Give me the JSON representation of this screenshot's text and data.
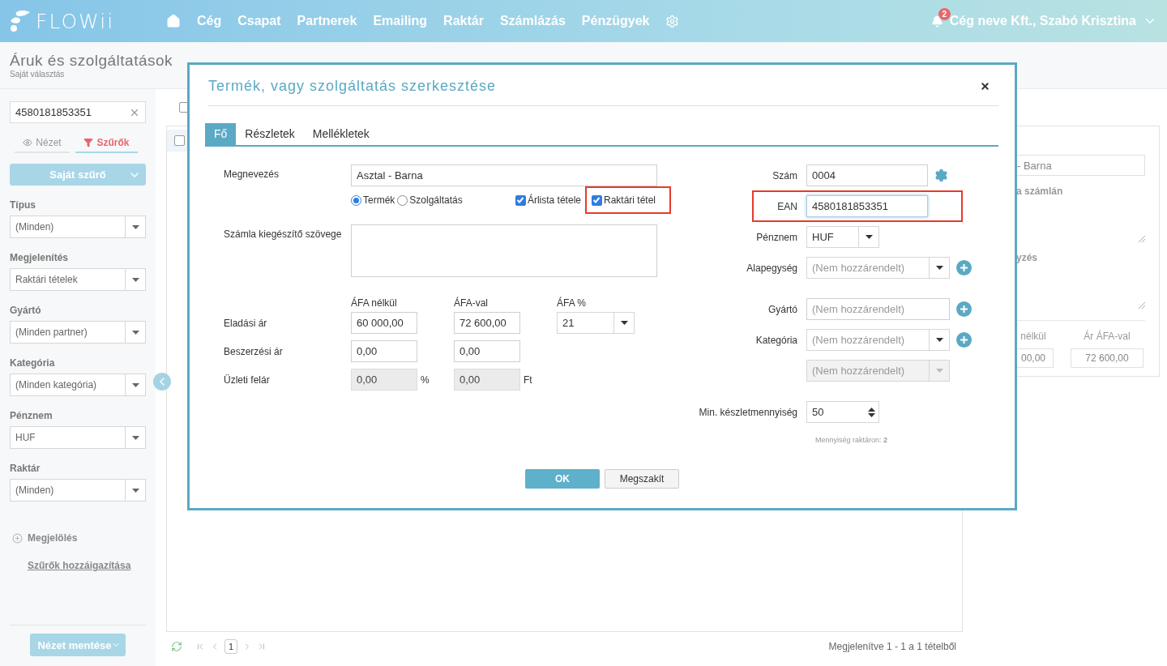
{
  "header": {
    "logo": "FLOWii",
    "nav": [
      {
        "kind": "home"
      },
      {
        "kind": "text",
        "label": "Cég"
      },
      {
        "kind": "text",
        "label": "Csapat"
      },
      {
        "kind": "text",
        "label": "Partnerek"
      },
      {
        "kind": "text",
        "label": "Emailing"
      },
      {
        "kind": "text",
        "label": "Raktár"
      },
      {
        "kind": "text",
        "label": "Számlázás"
      },
      {
        "kind": "text",
        "label": "Pénzügyek"
      },
      {
        "kind": "settings"
      }
    ],
    "notifications": "2",
    "account": "Cég neve Kft., Szabó Krisztina"
  },
  "page": {
    "title": "Áruk és szolgáltatások",
    "subtitle": "Saját választás"
  },
  "sidebar": {
    "search": {
      "value": "4580181853351"
    },
    "view_tabs": [
      {
        "label": "Nézet",
        "kind": "view",
        "selected": false
      },
      {
        "label": "Szűrők",
        "kind": "filter",
        "selected": true
      }
    ],
    "filter_button": "Saját szűrő",
    "filters": [
      {
        "label": "Típus",
        "value": "(Minden)"
      },
      {
        "label": "Megjelenítés",
        "value": "Raktári tételek"
      },
      {
        "label": "Gyártó",
        "value": "(Minden partner)"
      },
      {
        "label": "Kategória",
        "value": "(Minden kategória)"
      },
      {
        "label": "Pénznem",
        "value": "HUF"
      },
      {
        "label": "Raktár",
        "value": "(Minden)"
      }
    ],
    "mark": "Megjelölés",
    "adjust_link": "Szűrők hozzáigazítása",
    "save_button": "Nézet mentése"
  },
  "list": {
    "header_checked": false,
    "rows": [
      {
        "selected": true,
        "checked": false
      }
    ]
  },
  "pagination": {
    "page": "1",
    "summary": "Megjelenítve 1 - 1 a 1 tételből"
  },
  "detail_panel": {
    "name": "- Barna",
    "label_1": "a számlán",
    "label_2": "yzés",
    "column_1": "nélkül",
    "column_2": "Ár ÁFA-val",
    "value_1": "00,00",
    "value_2": "72 600,00"
  },
  "modal": {
    "title": "Termék, vagy szolgáltatás szerkesztése",
    "tabs": [
      {
        "label": "Fő",
        "selected": true
      },
      {
        "label": "Részletek",
        "selected": false
      },
      {
        "label": "Mellékletek",
        "selected": false
      }
    ],
    "name": {
      "label": "Megnevezés",
      "value": "Asztal - Barna"
    },
    "type_options": [
      {
        "label": "Termék",
        "selected": true
      },
      {
        "label": "Szolgáltatás",
        "selected": false
      }
    ],
    "flags": [
      {
        "label": "Árlista tétele",
        "checked": true,
        "highlighted": false
      },
      {
        "label": "Raktári tétel",
        "checked": true,
        "highlighted": true
      }
    ],
    "invoice_text": {
      "label": "Számla kiegészítő szövege"
    },
    "price_columns": [
      "ÁFA nélkül",
      "ÁFA-val",
      "ÁFA %"
    ],
    "prices": [
      {
        "label": "Eladási ár",
        "net": "60 000,00",
        "gross": "72 600,00",
        "vat": "21",
        "disabled": false
      },
      {
        "label": "Beszerzési ár",
        "net": "0,00",
        "gross": "0,00",
        "disabled": false
      },
      {
        "label": "Üzleti felár",
        "net": "0,00",
        "net_unit": "%",
        "gross": "0,00",
        "gross_unit": "Ft",
        "disabled": true
      }
    ],
    "field_groups": [
      [
        {
          "kind": "configinput",
          "label": "Szám",
          "value": "0004",
          "focused": false,
          "highlighted": false,
          "disabled": false
        },
        {
          "kind": "input",
          "label": "EAN",
          "value": "4580181853351",
          "focused": true,
          "highlighted": true,
          "disabled": false
        },
        {
          "kind": "shortselect",
          "label": "Pénznem",
          "value": "HUF",
          "focused": false,
          "highlighted": false,
          "disabled": false
        },
        {
          "kind": "addselect",
          "label": "Alapegység",
          "placeholder": "(Nem hozzárendelt)",
          "focused": false,
          "highlighted": false,
          "disabled": false
        }
      ],
      [
        {
          "kind": "addinput",
          "label": "Gyártó",
          "placeholder": "(Nem hozzárendelt)",
          "focused": false,
          "highlighted": false,
          "disabled": false
        },
        {
          "kind": "addselect",
          "label": "Kategória",
          "placeholder": "(Nem hozzárendelt)",
          "focused": false,
          "highlighted": false,
          "disabled": false
        },
        {
          "kind": "select",
          "placeholder": "(Nem hozzárendelt)",
          "focused": false,
          "highlighted": false,
          "disabled": true
        }
      ],
      [
        {
          "kind": "spinner",
          "label": "Min. készletmennyiség",
          "value": "50",
          "hint": "Mennyiség raktáron: **2**",
          "focused": false,
          "highlighted": false,
          "disabled": false
        }
      ]
    ],
    "buttons": [
      {
        "label": "OK",
        "kind": "primary"
      },
      {
        "label": "Megszakít",
        "kind": "secondary"
      }
    ]
  }
}
